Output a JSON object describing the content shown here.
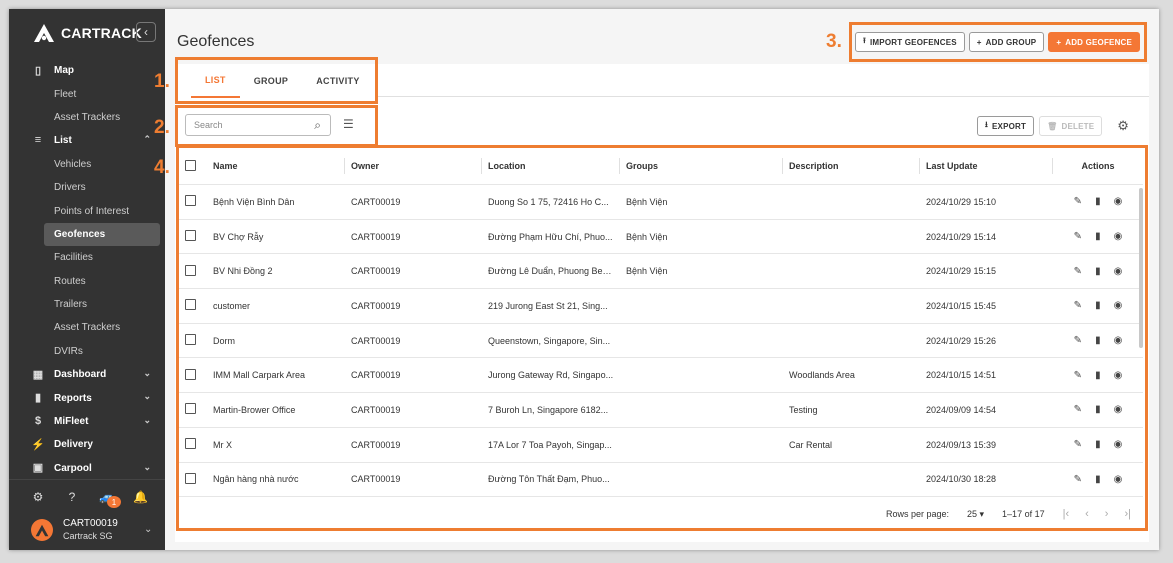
{
  "brand": {
    "name": "CARTRACK"
  },
  "sidebar": {
    "items": [
      {
        "label": "Map",
        "type": "section",
        "icon": "map-icon"
      },
      {
        "label": "Fleet",
        "type": "sub"
      },
      {
        "label": "Asset Trackers",
        "type": "sub"
      },
      {
        "label": "List",
        "type": "section",
        "icon": "list-icon",
        "chevron": "^"
      },
      {
        "label": "Vehicles",
        "type": "sub"
      },
      {
        "label": "Drivers",
        "type": "sub"
      },
      {
        "label": "Points of Interest",
        "type": "sub"
      },
      {
        "label": "Geofences",
        "type": "active"
      },
      {
        "label": "Facilities",
        "type": "sub"
      },
      {
        "label": "Routes",
        "type": "sub"
      },
      {
        "label": "Trailers",
        "type": "sub"
      },
      {
        "label": "Asset Trackers",
        "type": "sub"
      },
      {
        "label": "DVIRs",
        "type": "sub"
      },
      {
        "label": "Dashboard",
        "type": "section",
        "icon": "dashboard-icon",
        "chevron": "v"
      },
      {
        "label": "Reports",
        "type": "section",
        "icon": "reports-icon",
        "chevron": "v"
      },
      {
        "label": "MiFleet",
        "type": "section",
        "icon": "dollar-icon",
        "chevron": "v"
      },
      {
        "label": "Delivery",
        "type": "section",
        "icon": "bolt-icon"
      },
      {
        "label": "Carpool",
        "type": "section",
        "icon": "calendar-icon",
        "chevron": "v"
      }
    ],
    "notification_count": "1",
    "user": {
      "name": "CART00019",
      "company": "Cartrack SG"
    }
  },
  "header": {
    "title": "Geofences",
    "buttons": {
      "import": "IMPORT GEOFENCES",
      "add_group": "ADD GROUP",
      "add_geofence": "ADD GEOFENCE"
    }
  },
  "callouts": {
    "one": "1.",
    "two": "2.",
    "three": "3.",
    "four": "4."
  },
  "tabs": [
    {
      "label": "LIST"
    },
    {
      "label": "GROUP"
    },
    {
      "label": "ACTIVITY"
    }
  ],
  "search": {
    "placeholder": "Search"
  },
  "tools": {
    "export": "EXPORT",
    "delete": "DELETE"
  },
  "table": {
    "columns": [
      "Name",
      "Owner",
      "Location",
      "Groups",
      "Description",
      "Last Update",
      "Actions"
    ],
    "rows": [
      {
        "name": "Bệnh Viện Bình Dân",
        "owner": "CART00019",
        "location": "Duong So 1 75, 72416 Ho C...",
        "groups": "Bệnh Viện",
        "description": "",
        "updated": "2024/10/29 15:10"
      },
      {
        "name": "BV Chợ Rẫy",
        "owner": "CART00019",
        "location": "Đường Phạm Hữu Chí, Phuo...",
        "groups": "Bệnh Viện",
        "description": "",
        "updated": "2024/10/29 15:14"
      },
      {
        "name": "BV Nhi Đồng 2",
        "owner": "CART00019",
        "location": "Đường Lê Duẩn, Phuong Ben...",
        "groups": "Bệnh Viện",
        "description": "",
        "updated": "2024/10/29 15:15"
      },
      {
        "name": "customer",
        "owner": "CART00019",
        "location": "219 Jurong East St 21, Sing...",
        "groups": "",
        "description": "",
        "updated": "2024/10/15 15:45"
      },
      {
        "name": "Dorm",
        "owner": "CART00019",
        "location": "Queenstown, Singapore, Sin...",
        "groups": "",
        "description": "",
        "updated": "2024/10/29 15:26"
      },
      {
        "name": "IMM Mall Carpark Area",
        "owner": "CART00019",
        "location": "Jurong Gateway Rd, Singapo...",
        "groups": "",
        "description": "Woodlands Area",
        "updated": "2024/10/15 14:51"
      },
      {
        "name": "Martin-Brower Office",
        "owner": "CART00019",
        "location": "7 Buroh Ln, Singapore 6182...",
        "groups": "",
        "description": "Testing",
        "updated": "2024/09/09 14:54"
      },
      {
        "name": "Mr X",
        "owner": "CART00019",
        "location": "17A Lor 7 Toa Payoh, Singap...",
        "groups": "",
        "description": "Car Rental",
        "updated": "2024/09/13 15:39"
      },
      {
        "name": "Ngân hàng nhà nước",
        "owner": "CART00019",
        "location": "Đường Tôn Thất Đạm, Phuo...",
        "groups": "",
        "description": "",
        "updated": "2024/10/30 18:28"
      }
    ]
  },
  "footer": {
    "rows_per_page_label": "Rows per page:",
    "rows_per_page": "25",
    "range": "1–17 of 17"
  }
}
